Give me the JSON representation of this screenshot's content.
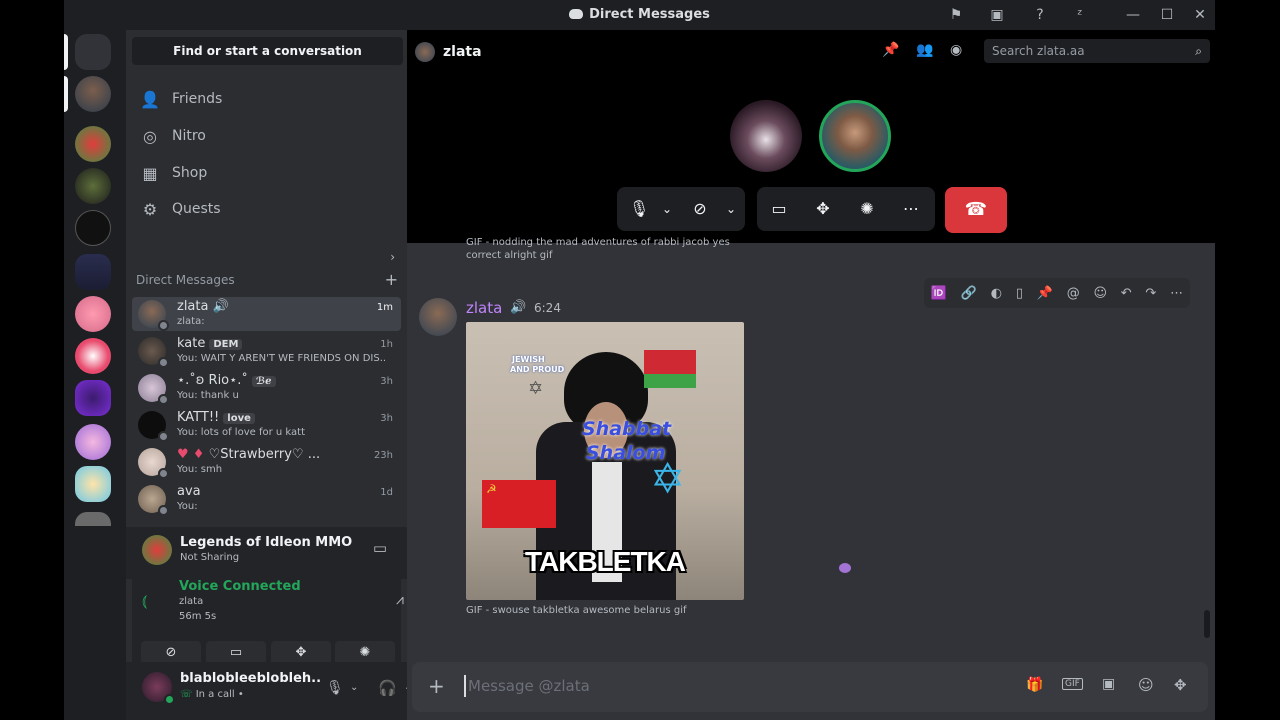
{
  "window": {
    "title": "Direct Messages"
  },
  "sidebar": {
    "find_label": "Find or start a conversation",
    "nav": [
      {
        "label": "Friends",
        "icon": "friends-icon"
      },
      {
        "label": "Nitro",
        "icon": "nitro-icon"
      },
      {
        "label": "Shop",
        "icon": "shop-icon"
      },
      {
        "label": "Quests",
        "icon": "quests-icon"
      }
    ],
    "dm_header": "Direct Messages",
    "dms": [
      {
        "name": "zlata",
        "sub": "zlata:",
        "time": "1m",
        "tag": ""
      },
      {
        "name": "kate",
        "sub": "You: WAIT Y AREN'T WE FRIENDS ON DIS...",
        "time": "1h",
        "tag": "DEM"
      },
      {
        "name": "⋆.˚ʚ Rio⋆.˚",
        "sub": "You: thank u",
        "time": "3h",
        "tag": "ℬℯ"
      },
      {
        "name": "KATT!!",
        "sub": "You: lots of love for u katt",
        "time": "3h",
        "tag": "love"
      },
      {
        "name": "♡Strawberry♡ ...",
        "sub": "You: smh",
        "time": "23h",
        "tag": ""
      },
      {
        "name": "ava",
        "sub": "You:",
        "time": "1d",
        "tag": ""
      }
    ],
    "activity": {
      "title": "Legends of Idleon MMO",
      "sub": "Not Sharing"
    },
    "voice": {
      "status": "Voice Connected",
      "channel": "zlata",
      "duration": "56m 5s"
    },
    "user": {
      "name": "blablobleeblobleh...",
      "status": "In a call •"
    }
  },
  "main": {
    "recipient": "zlata",
    "search_placeholder": "Search zlata.aa",
    "prev_caption_line1": "GIF - nodding the mad adventures of rabbi jacob yes",
    "prev_caption_line2": "correct alright gif",
    "message": {
      "author": "zlata",
      "time": "6:24"
    },
    "gif": {
      "top_text_1": "JEWISH",
      "top_text_2": "AND PROUD",
      "blue_text_1": "Shabbat",
      "blue_text_2": "Shalom",
      "bottom_text": "TAKBLETKA"
    },
    "gif_caption": "GIF - swouse takbletka awesome belarus gif",
    "composer_placeholder": "Message @zlata"
  },
  "colors": {
    "accent": "#5865f2",
    "voice_green": "#23a55a",
    "hangup": "#da373c",
    "author": "#c084fc"
  }
}
